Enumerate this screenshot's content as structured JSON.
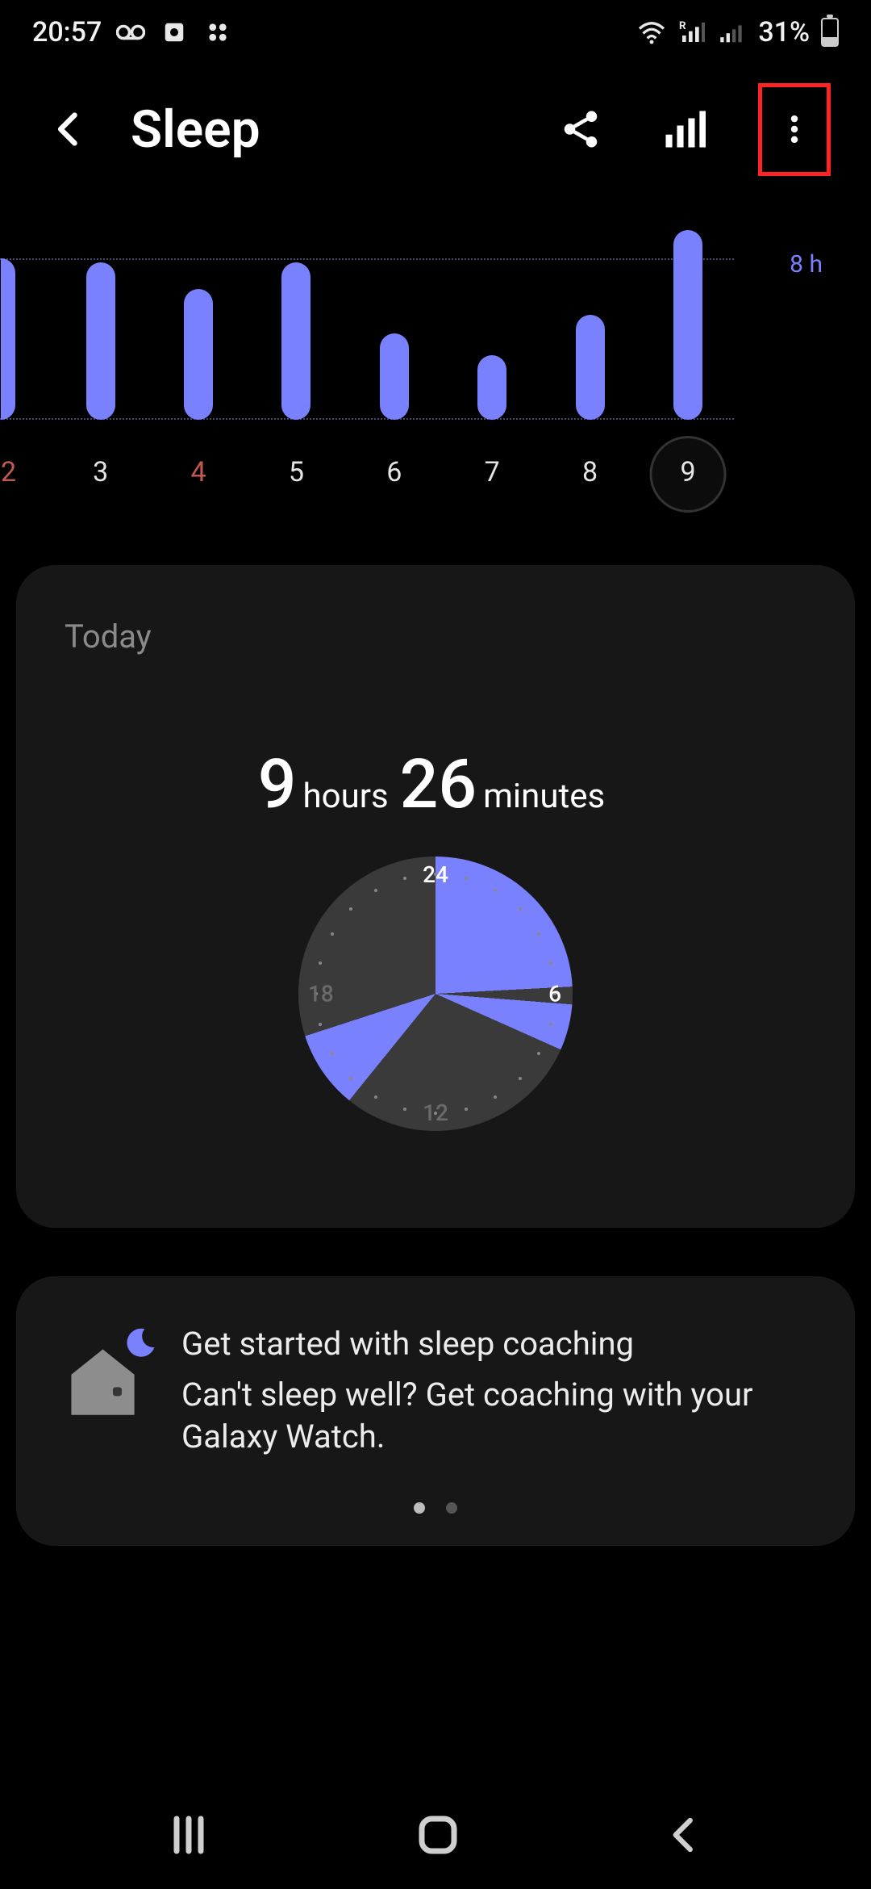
{
  "status": {
    "time": "20:57",
    "battery_pct": "31%",
    "battery_fill_pct": 31
  },
  "header": {
    "title": "Sleep"
  },
  "chart_data": {
    "type": "bar",
    "categories": [
      "2",
      "3",
      "4",
      "5",
      "6",
      "7",
      "8",
      "9"
    ],
    "values": [
      8.0,
      7.8,
      6.5,
      7.8,
      4.3,
      3.2,
      5.2,
      9.4
    ],
    "target_hours": 8,
    "target_label": "8 h",
    "ylim": [
      0,
      10
    ],
    "weekend_indices": [
      0,
      2
    ],
    "selected_index": 7,
    "partial_first": true
  },
  "today": {
    "section_label": "Today",
    "hours": "9",
    "hours_unit": "hours",
    "minutes": "26",
    "minutes_unit": "minutes",
    "clock_labels": {
      "top": "24",
      "right": "6",
      "bottom": "12",
      "left": "18"
    },
    "sleep_segments": [
      {
        "start_hour": 0.0,
        "end_hour": 5.8
      },
      {
        "start_hour": 6.3,
        "end_hour": 7.6
      },
      {
        "start_hour": 14.6,
        "end_hour": 16.8
      }
    ]
  },
  "coaching": {
    "title": "Get started with sleep coaching",
    "body": "Can't sleep well? Get coaching with your Galaxy Watch.",
    "page_count": 2,
    "active_page": 0
  }
}
